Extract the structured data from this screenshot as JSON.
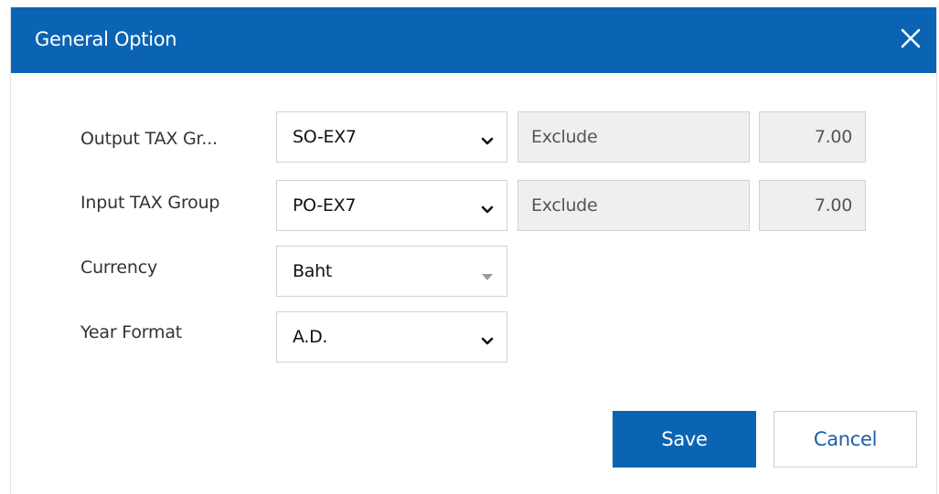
{
  "dialog": {
    "title": "General Option",
    "close_icon": "close-icon"
  },
  "form": {
    "output_tax": {
      "label": "Output TAX Gr...",
      "selected": "SO-EX7",
      "tax_type": "Exclude",
      "tax_rate": "7.00"
    },
    "input_tax": {
      "label": "Input TAX Group",
      "selected": "PO-EX7",
      "tax_type": "Exclude",
      "tax_rate": "7.00"
    },
    "currency": {
      "label": "Currency",
      "selected": "Baht"
    },
    "year_format": {
      "label": "Year Format",
      "selected": "A.D."
    }
  },
  "actions": {
    "save_label": "Save",
    "cancel_label": "Cancel"
  },
  "colors": {
    "header_bg": "#0b64b3",
    "primary_button": "#0b64b3",
    "readonly_bg": "#efefef"
  }
}
